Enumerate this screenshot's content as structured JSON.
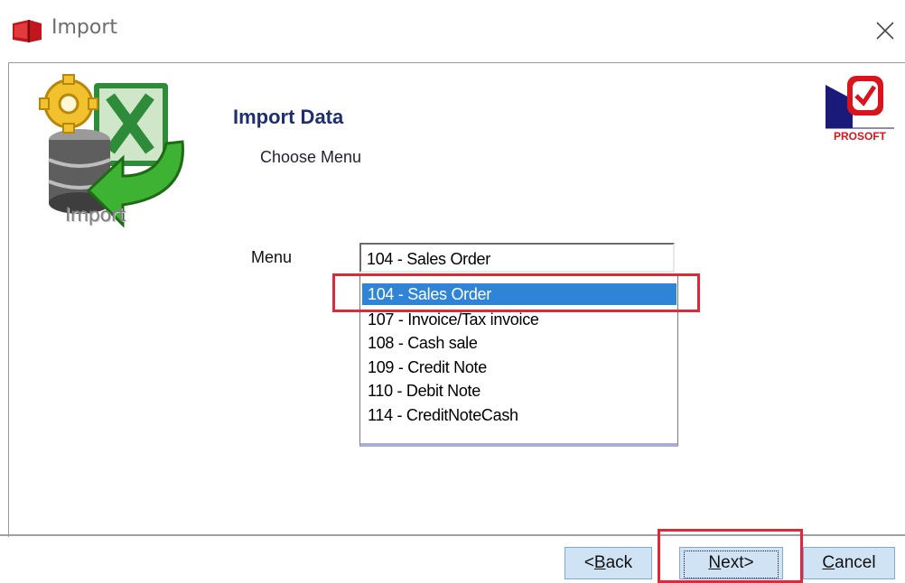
{
  "window": {
    "title": "Import",
    "icons": {
      "app": "red-book-icon",
      "close": "close-icon"
    }
  },
  "logo": {
    "label": "Import",
    "icon": "import-excel-database-icon"
  },
  "brand": {
    "name": "PROSOFT",
    "icon": "prosoft-logo"
  },
  "header": {
    "title": "Import Data",
    "subtitle": "Choose Menu"
  },
  "form": {
    "menu_label": "Menu",
    "menu_value": "104 - Sales Order",
    "options": [
      "104 - Sales Order",
      "107 - Invoice/Tax invoice",
      "108 - Cash sale",
      "109 - Credit Note",
      "110 - Debit Note",
      "114 - CreditNoteCash"
    ],
    "selected_index": 0
  },
  "buttons": {
    "back": {
      "mnemonic": "B",
      "rest": "ack",
      "prefix": "<"
    },
    "next": {
      "mnemonic": "N",
      "rest": "ext>"
    },
    "cancel": {
      "mnemonic": "C",
      "rest": "ancel"
    }
  },
  "colors": {
    "highlight": "#e0283a",
    "selection": "#2f84d8",
    "heading": "#1f2f6e"
  }
}
